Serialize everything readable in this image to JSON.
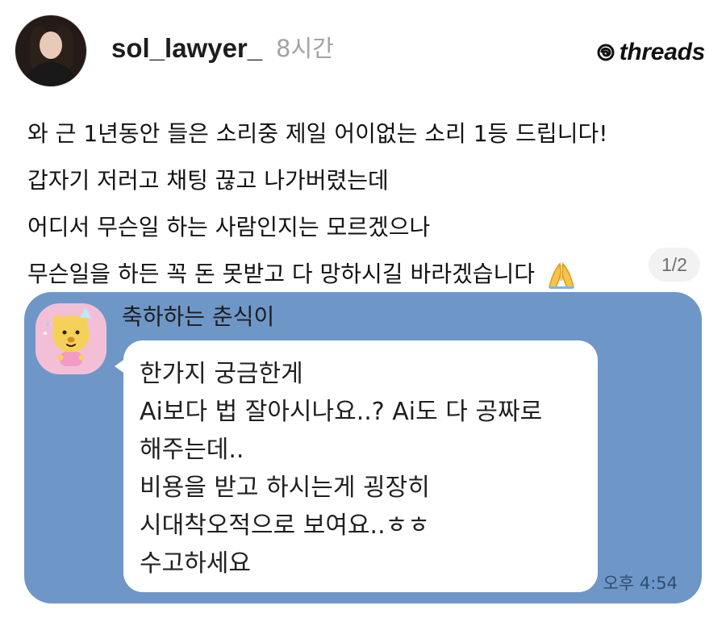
{
  "post": {
    "username": "sol_lawyer_",
    "time": "8시간",
    "brand": {
      "icon": "threads-icon",
      "text": "threads"
    },
    "lines": [
      "와 근 1년동안 들은 소리중 제일 어이없는 소리 1등 드립니다!",
      "갑자기 저러고 채팅 끊고 나가버렸는데",
      "어디서 무슨일 하는 사람인지는 모르겠으나",
      "무슨일을 하든 꼭 돈 못받고 다 망하시길 바라겠습니다"
    ],
    "emoji": "folded-hands-icon",
    "page_counter": "1/2"
  },
  "chat": {
    "sender_name": "축하하는 춘식이",
    "messages": [
      "한가지 궁금한게",
      "Ai보다 법 잘아시나요..? Ai도 다 공짜로",
      "해주는데..",
      "비용을 받고 하시는게 굉장히",
      "시대착오적으로 보여요..ㅎㅎ",
      "수고하세요"
    ],
    "time": "오후 4:54",
    "colors": {
      "background": "#6e97c8",
      "bubble": "#ffffff",
      "avatar_bg": "#f3bfd7"
    }
  }
}
